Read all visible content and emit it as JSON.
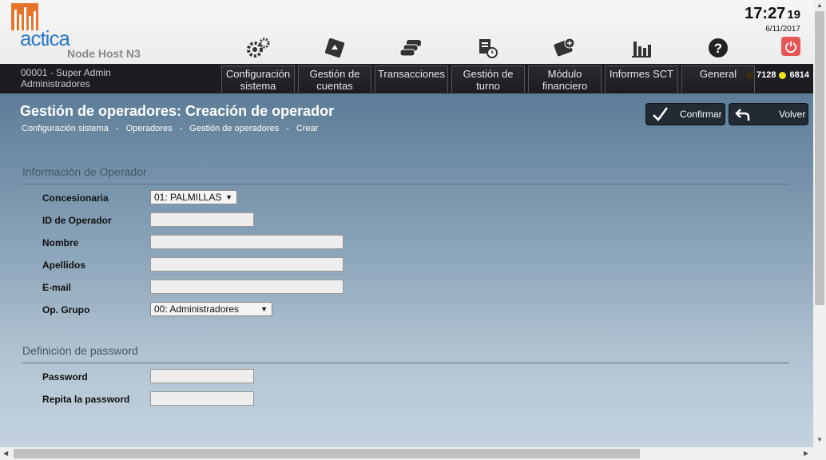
{
  "brand": {
    "name": "actica",
    "subtitle": "Node Host N3",
    "color": "#2a78c8",
    "logo_color": "#e8742a"
  },
  "clock": {
    "time": "17:27",
    "seconds": "19",
    "date": "6/11/2017"
  },
  "toolbar_icons": [
    "gear-icon",
    "card-icon",
    "cars-icon",
    "ticket-clock-icon",
    "financial-icon",
    "bar-chart-icon",
    "help-icon"
  ],
  "user": {
    "line1": "00001 - Super Admin",
    "line2": "Administradores"
  },
  "menu": [
    {
      "line1": "Configuración",
      "line2": "sistema"
    },
    {
      "line1": "Gestión de",
      "line2": "cuentas"
    },
    {
      "line1": "Transacciones",
      "line2": ""
    },
    {
      "line1": "Gestión de",
      "line2": "turno"
    },
    {
      "line1": "Módulo",
      "line2": "financiero"
    },
    {
      "line1": "Informes SCT",
      "line2": ""
    },
    {
      "line1": "General",
      "line2": ""
    }
  ],
  "counters": {
    "first": "7128",
    "second": "6814",
    "first_color": "#3a2d12",
    "second_color": "#f0e020"
  },
  "page": {
    "title": "Gestión de operadores: Creación de operador"
  },
  "breadcrumb": [
    "Configuración sistema",
    "-",
    "Operadores",
    "-",
    "Gestión de operadores",
    "-",
    "Crear"
  ],
  "actions": {
    "confirm": "Confirmar",
    "back": "Volver"
  },
  "operator_section": {
    "title": "Información de Operador",
    "concesionaria_label": "Concesionaria",
    "concesionaria_value": "01: PALMILLAS",
    "id_label": "ID de Operador",
    "id_value": "",
    "nombre_label": "Nombre",
    "nombre_value": "",
    "apellidos_label": "Apellidos",
    "apellidos_value": "",
    "email_label": "E-mail",
    "email_value": "",
    "grupo_label": "Op. Grupo",
    "grupo_value": "00: Administradores"
  },
  "password_section": {
    "title": "Definición de password",
    "password_label": "Password",
    "repeat_label": "Repita la password"
  }
}
